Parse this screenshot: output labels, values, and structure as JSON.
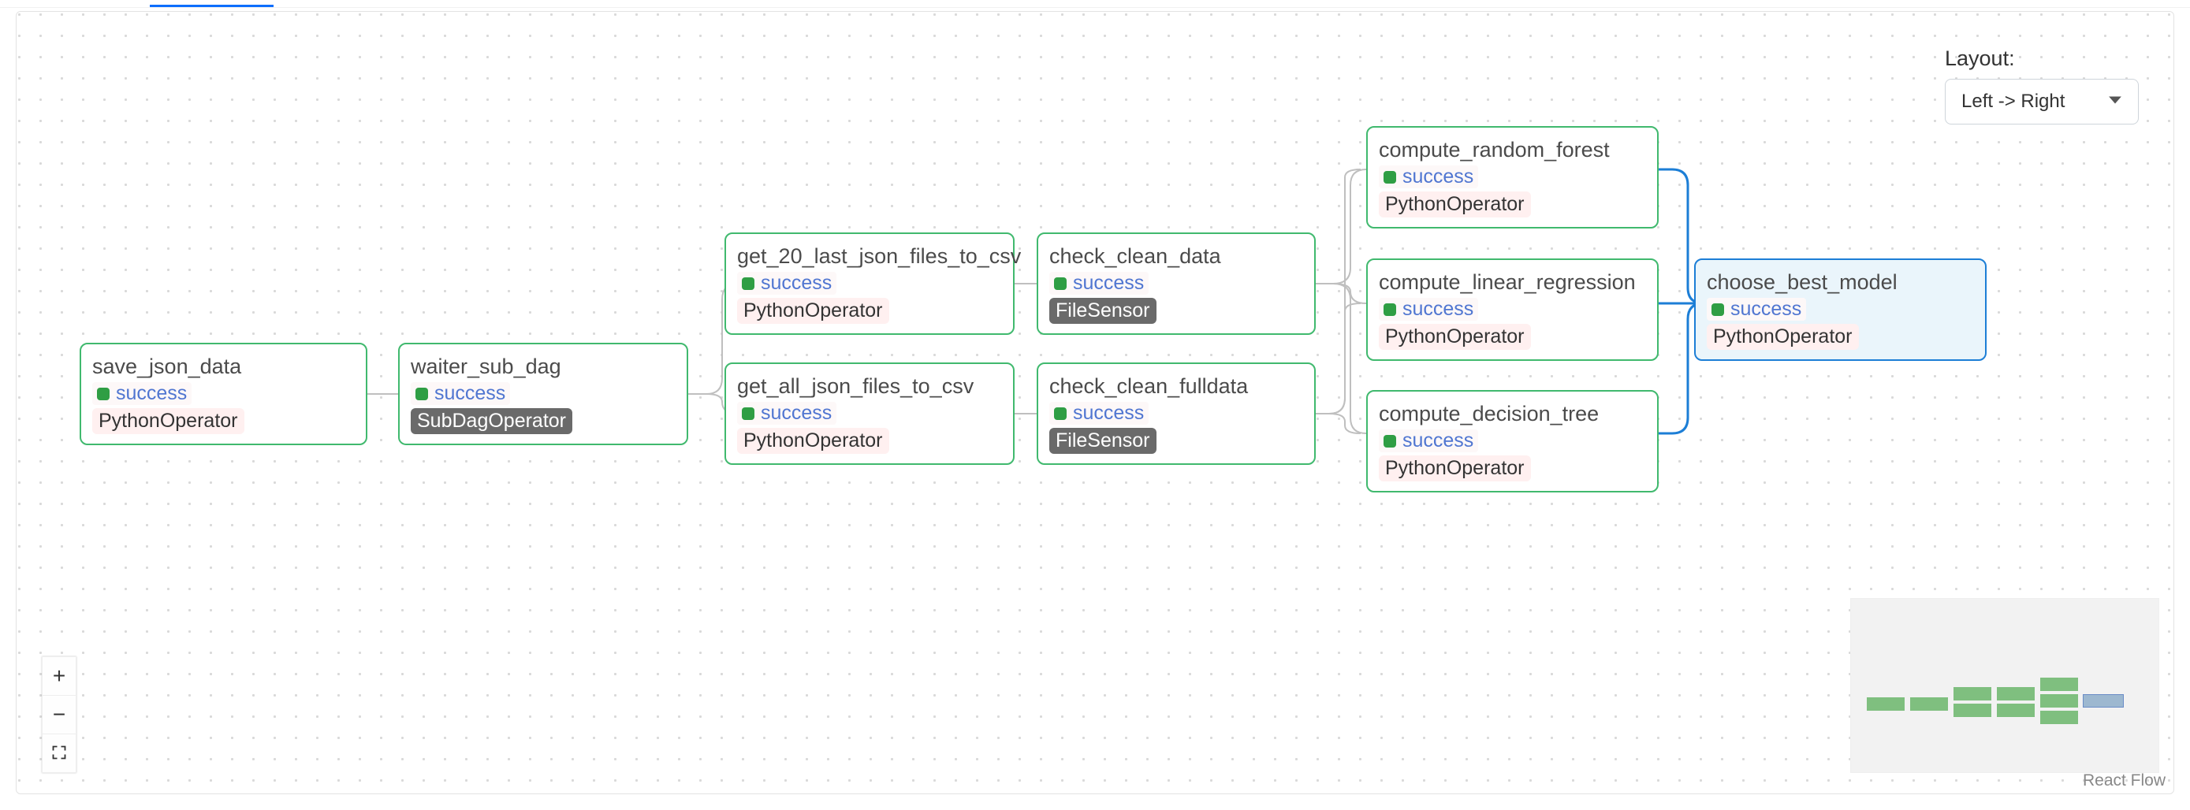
{
  "layout_label": "Layout:",
  "layout_value": "Left -> Right",
  "attribution": "React Flow",
  "status_label": "success",
  "op": {
    "python": "PythonOperator",
    "subdag": "SubDagOperator",
    "sensor": "FileSensor"
  },
  "nodes": {
    "save_json_data": {
      "title": "save_json_data",
      "op": "python"
    },
    "waiter_sub_dag": {
      "title": "waiter_sub_dag",
      "op": "subdag"
    },
    "get_20_last_json_files_to_csv": {
      "title": "get_20_last_json_files_to_csv",
      "op": "python"
    },
    "get_all_json_files_to_csv": {
      "title": "get_all_json_files_to_csv",
      "op": "python"
    },
    "check_clean_data": {
      "title": "check_clean_data",
      "op": "sensor"
    },
    "check_clean_fulldata": {
      "title": "check_clean_fulldata",
      "op": "sensor"
    },
    "compute_random_forest": {
      "title": "compute_random_forest",
      "op": "python"
    },
    "compute_linear_regression": {
      "title": "compute_linear_regression",
      "op": "python"
    },
    "compute_decision_tree": {
      "title": "compute_decision_tree",
      "op": "python"
    },
    "choose_best_model": {
      "title": "choose_best_model",
      "op": "python"
    }
  }
}
